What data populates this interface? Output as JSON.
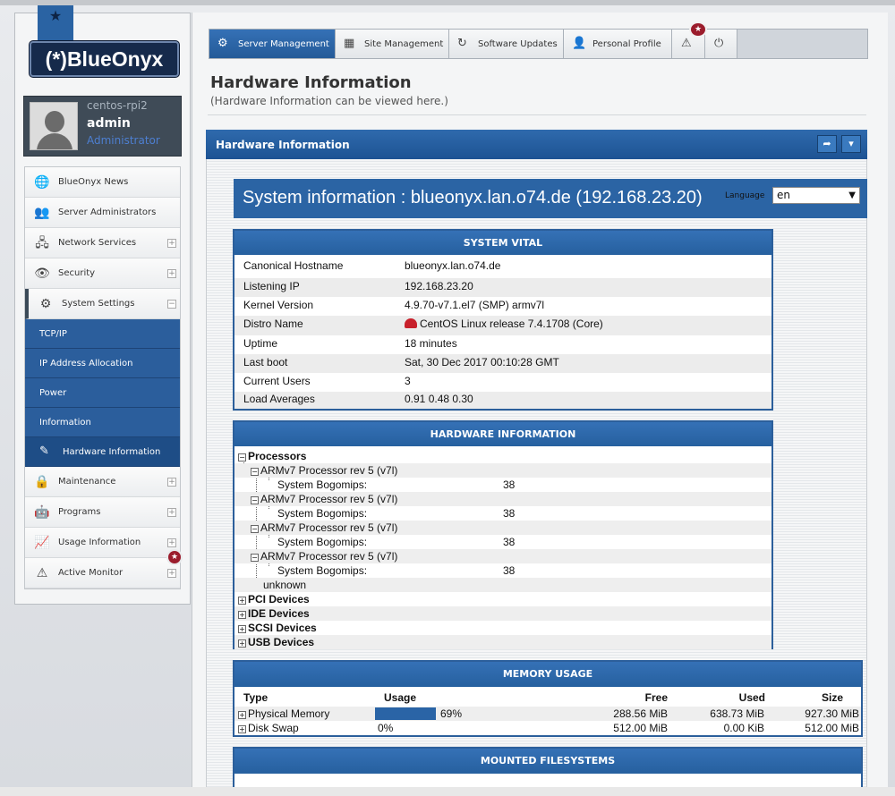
{
  "brand": {
    "logo_text": "(*)BlueOnyx"
  },
  "user": {
    "host": "centos-rpi2",
    "name": "admin",
    "role": "Administrator"
  },
  "sidebar": {
    "items": [
      {
        "label": "BlueOnyx News",
        "icon": "globe-icon"
      },
      {
        "label": "Server Administrators",
        "icon": "users-icon"
      },
      {
        "label": "Network Services",
        "icon": "network-icon"
      },
      {
        "label": "Security",
        "icon": "eye-icon"
      },
      {
        "label": "System Settings",
        "icon": "gear-icon"
      },
      {
        "label": "Maintenance",
        "icon": "lock-icon"
      },
      {
        "label": "Programs",
        "icon": "robot-icon"
      },
      {
        "label": "Usage Information",
        "icon": "chart-icon"
      },
      {
        "label": "Active Monitor",
        "icon": "warning-icon"
      }
    ],
    "subitems": [
      {
        "label": "TCP/IP"
      },
      {
        "label": "IP Address Allocation"
      },
      {
        "label": "Power"
      },
      {
        "label": "Information"
      },
      {
        "label": "Hardware Information",
        "active": true
      }
    ],
    "badge": "★"
  },
  "nav": {
    "tabs": [
      {
        "label": "Server Management",
        "icon": "gear-icon"
      },
      {
        "label": "Site Management",
        "icon": "grid-icon"
      },
      {
        "label": "Software Updates",
        "icon": "refresh-icon"
      },
      {
        "label": "Personal Profile",
        "icon": "person-icon"
      }
    ],
    "badge": "★"
  },
  "page": {
    "title": "Hardware Information",
    "subtitle": "(Hardware Information can be viewed here.)",
    "panel_title": "Hardware Information"
  },
  "system": {
    "header": "System information : blueonyx.lan.o74.de (192.168.23.20)",
    "language_label": "Language",
    "language_value": "en"
  },
  "vital": {
    "title": "SYSTEM VITAL",
    "rows": [
      {
        "key": "Canonical Hostname",
        "value": "blueonyx.lan.o74.de"
      },
      {
        "key": "Listening IP",
        "value": "192.168.23.20"
      },
      {
        "key": "Kernel Version",
        "value": "4.9.70-v7.1.el7 (SMP) armv7l"
      },
      {
        "key": "Distro Name",
        "value": "CentOS Linux release 7.4.1708 (Core)"
      },
      {
        "key": "Uptime",
        "value": "18 minutes"
      },
      {
        "key": "Last boot",
        "value": "Sat, 30 Dec 2017 00:10:28 GMT"
      },
      {
        "key": "Current Users",
        "value": "3"
      },
      {
        "key": "Load Averages",
        "value": "0.91 0.48 0.30"
      }
    ]
  },
  "hardware": {
    "title": "HARDWARE INFORMATION",
    "processors_label": "Processors",
    "processors": [
      {
        "name": "ARMv7 Processor rev 5 (v7l)",
        "bogomips_label": "System Bogomips:",
        "bogomips": "38"
      },
      {
        "name": "ARMv7 Processor rev 5 (v7l)",
        "bogomips_label": "System Bogomips:",
        "bogomips": "38"
      },
      {
        "name": "ARMv7 Processor rev 5 (v7l)",
        "bogomips_label": "System Bogomips:",
        "bogomips": "38"
      },
      {
        "name": "ARMv7 Processor rev 5 (v7l)",
        "bogomips_label": "System Bogomips:",
        "bogomips": "38"
      }
    ],
    "unknown": "unknown",
    "devices": [
      "PCI Devices",
      "IDE Devices",
      "SCSI Devices",
      "USB Devices"
    ]
  },
  "memory": {
    "title": "MEMORY USAGE",
    "headers": {
      "type": "Type",
      "usage": "Usage",
      "free": "Free",
      "used": "Used",
      "size": "Size"
    },
    "rows": [
      {
        "type": "Physical Memory",
        "usage": "69%",
        "usage_fraction": 0.69,
        "free": "288.56 MiB",
        "used": "638.73 MiB",
        "size": "927.30 MiB"
      },
      {
        "type": "Disk Swap",
        "usage": "0%",
        "usage_fraction": 0.0,
        "free": "512.00 MiB",
        "used": "0.00 KiB",
        "size": "512.00 MiB"
      }
    ]
  },
  "filesystems": {
    "title": "MOUNTED FILESYSTEMS"
  }
}
